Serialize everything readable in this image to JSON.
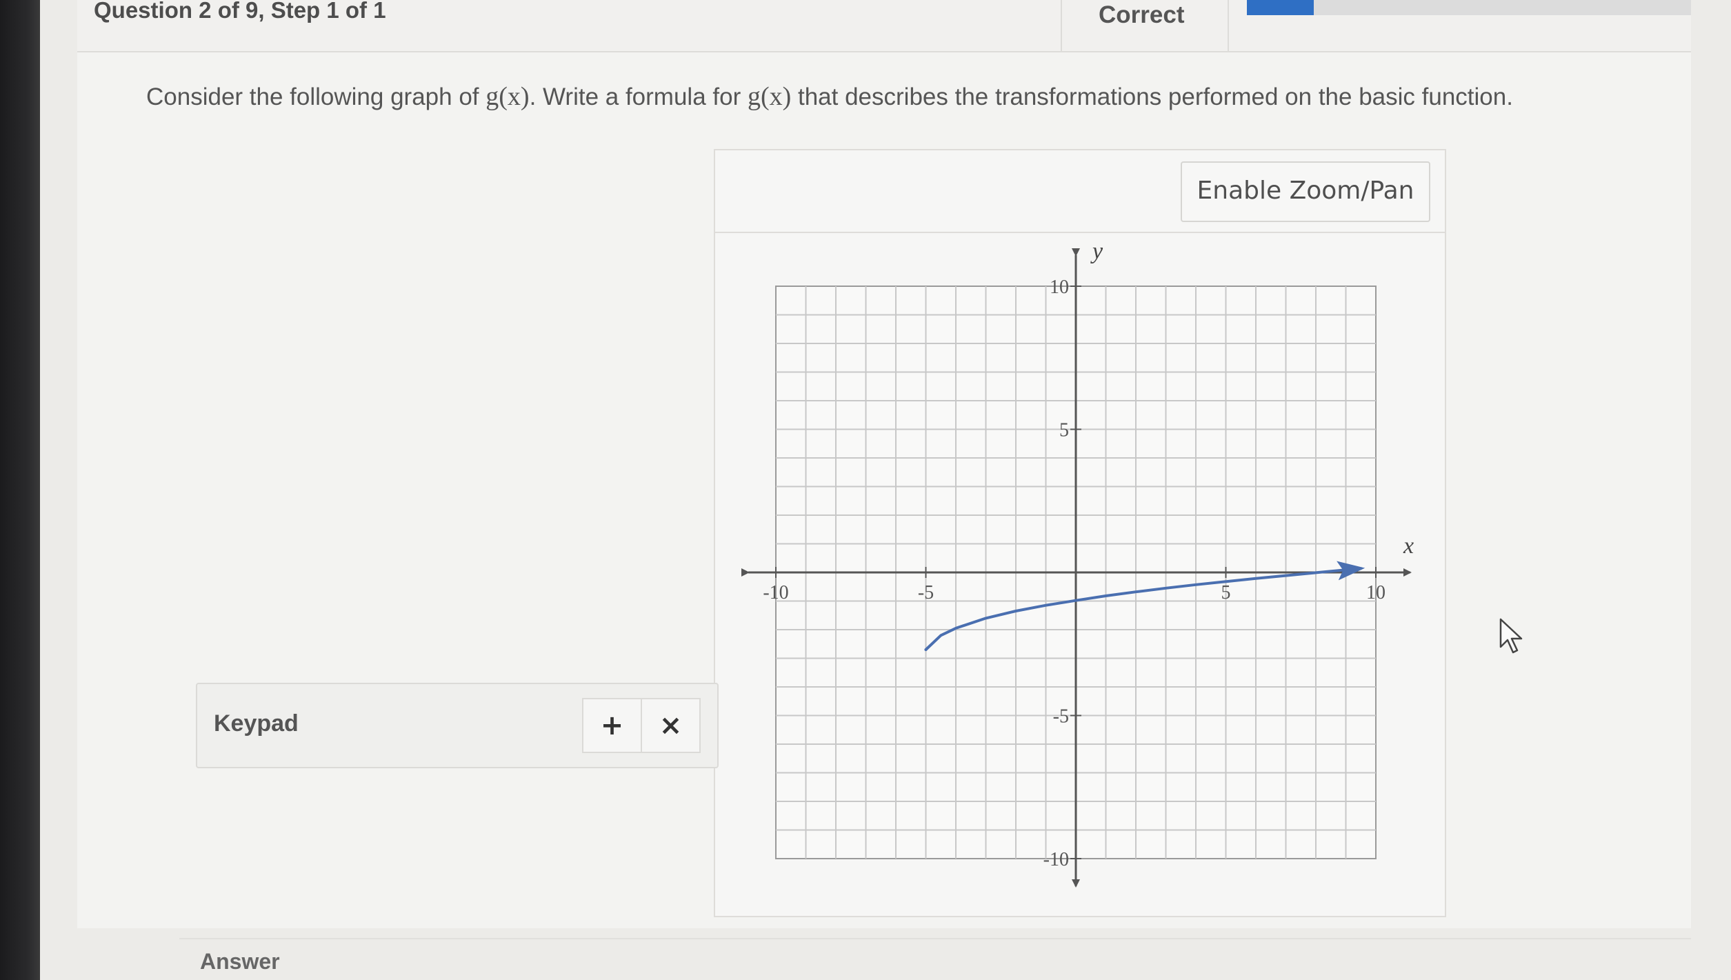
{
  "header": {
    "question_label": "Question 2 of 9, Step 1 of 1",
    "status": "Correct"
  },
  "prompt": {
    "part1": "Consider the following graph of ",
    "fn1": "g(x)",
    "part2": ". Write a formula for ",
    "fn2": "g(x)",
    "part3": " that describes the transformations performed on the basic function."
  },
  "graph_panel": {
    "zoom_button": "Enable Zoom/Pan"
  },
  "keypad": {
    "label": "Keypad",
    "add_symbol": "+",
    "close_symbol": "×"
  },
  "answer": {
    "label": "Answer"
  },
  "colors": {
    "curve": "#4a6fb0",
    "axis": "#555555",
    "grid": "#c8c8c8",
    "progress": "#2f6fc4"
  },
  "chart_data": {
    "type": "line",
    "xlabel": "x",
    "ylabel": "y",
    "xlim": [
      -10,
      10
    ],
    "ylim": [
      -10,
      10
    ],
    "grid": true,
    "x_ticks": [
      "-10",
      "-5",
      "5",
      "10"
    ],
    "y_ticks": [
      "10",
      "5",
      "-5",
      "-10"
    ],
    "series": [
      {
        "x": [
          -5,
          -4.5,
          -4,
          -3,
          -2,
          -1,
          0,
          1,
          2,
          3,
          4,
          5,
          6,
          7,
          8,
          9,
          9.5
        ],
        "y": [
          -2.7,
          -2.2,
          -1.95,
          -1.6,
          -1.35,
          -1.15,
          -0.98,
          -0.82,
          -0.68,
          -0.55,
          -0.43,
          -0.32,
          -0.21,
          -0.11,
          -0.01,
          0.09,
          0.14
        ]
      }
    ]
  }
}
